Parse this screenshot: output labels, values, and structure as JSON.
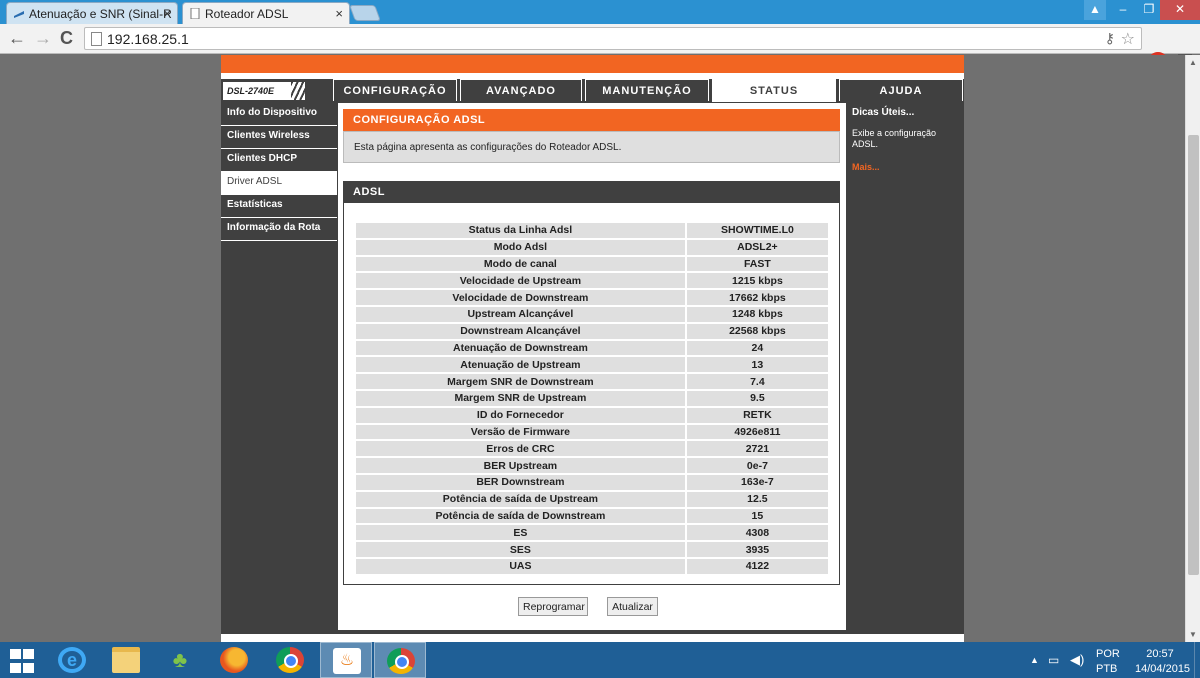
{
  "browser": {
    "tabs": [
      {
        "title": "Atenuação e SNR (Sinal-R",
        "close": "×"
      },
      {
        "title": "Roteador ADSL",
        "close": "×"
      }
    ],
    "window_controls": {
      "minimize": "–",
      "maximize": "❐",
      "close": "✕"
    },
    "nav": {
      "back": "←",
      "forward": "→",
      "reload": "C"
    },
    "url": "192.168.25.1",
    "icons": {
      "star": "☆",
      "key": "⚷"
    }
  },
  "router": {
    "model": "DSL-2740E",
    "tabs": [
      {
        "label": "CONFIGURAÇÃO",
        "active": false
      },
      {
        "label": "AVANÇADO",
        "active": false
      },
      {
        "label": "MANUTENÇÃO",
        "active": false
      },
      {
        "label": "STATUS",
        "active": true
      },
      {
        "label": "AJUDA",
        "active": false
      }
    ],
    "sidebar": [
      {
        "label": "Info do Dispositivo",
        "active": false
      },
      {
        "label": "Clientes Wireless",
        "active": false
      },
      {
        "label": "Clientes DHCP",
        "active": false
      },
      {
        "label": "Driver ADSL",
        "active": true
      },
      {
        "label": "Estatísticas",
        "active": false
      },
      {
        "label": "Informação da Rota",
        "active": false
      }
    ],
    "section_title": "CONFIGURAÇÃO ADSL",
    "intro": "Esta página apresenta as configurações do Roteador ADSL.",
    "table_title": "ADSL",
    "rows": [
      {
        "label": "Status da Linha Adsl",
        "value": "SHOWTIME.L0"
      },
      {
        "label": "Modo Adsl",
        "value": "ADSL2+"
      },
      {
        "label": "Modo de canal",
        "value": "FAST"
      },
      {
        "label": "Velocidade de Upstream",
        "value": "1215 kbps"
      },
      {
        "label": "Velocidade de Downstream",
        "value": "17662 kbps"
      },
      {
        "label": "Upstream Alcançável",
        "value": "1248 kbps"
      },
      {
        "label": "Downstream Alcançável",
        "value": "22568 kbps"
      },
      {
        "label": "Atenuação de Downstream",
        "value": "24"
      },
      {
        "label": "Atenuação de Upstream",
        "value": "13"
      },
      {
        "label": "Margem SNR de Downstream",
        "value": "7.4"
      },
      {
        "label": "Margem SNR de Upstream",
        "value": "9.5"
      },
      {
        "label": "ID do Fornecedor",
        "value": "RETK"
      },
      {
        "label": "Versão de Firmware",
        "value": "4926e811"
      },
      {
        "label": "Erros de CRC",
        "value": "2721"
      },
      {
        "label": "BER Upstream",
        "value": "0e-7"
      },
      {
        "label": "BER Downstream",
        "value": "163e-7"
      },
      {
        "label": "Potência de saída de Upstream",
        "value": "12.5"
      },
      {
        "label": "Potência de saída de Downstream",
        "value": "15"
      },
      {
        "label": "ES",
        "value": "4308"
      },
      {
        "label": "SES",
        "value": "3935"
      },
      {
        "label": "UAS",
        "value": "4122"
      }
    ],
    "buttons": {
      "reprogram": "Reprogramar",
      "refresh": "Atualizar"
    },
    "hints": {
      "title": "Dicas Úteis...",
      "text": "Exibe a configuração ADSL.",
      "more": "Mais..."
    },
    "colors": {
      "accent": "#f26522",
      "dark": "#404040"
    }
  },
  "taskbar": {
    "apps": [
      "windows-start",
      "internet-explorer",
      "file-explorer",
      "people",
      "firefox",
      "chrome",
      "java",
      "chrome-active"
    ],
    "lang_top": "POR",
    "lang_bottom": "PTB",
    "time": "20:57",
    "date": "14/04/2015"
  }
}
